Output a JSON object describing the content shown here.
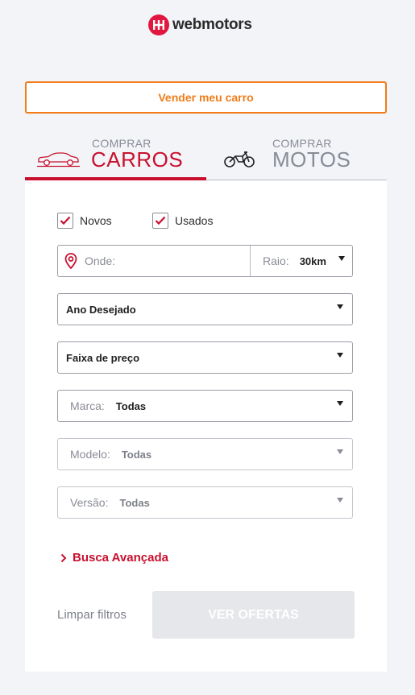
{
  "brand": {
    "name": "webmotors",
    "color": "#e1173f",
    "icon": "webmotors-logo-icon"
  },
  "header": {
    "sell_label": "Vender meu carro",
    "accent": "#f07c1a"
  },
  "tabs": [
    {
      "small": "COMPRAR",
      "big": "CARROS",
      "icon": "car-icon",
      "active": true
    },
    {
      "small": "COMPRAR",
      "big": "MOTOS",
      "icon": "motorcycle-icon",
      "active": false
    }
  ],
  "filters": {
    "new_label": "Novos",
    "new_checked": true,
    "used_label": "Usados",
    "used_checked": true,
    "location": {
      "placeholder": "Onde:",
      "radius_label": "Raio:",
      "radius_value": "30km",
      "icon": "location-pin-icon"
    },
    "year": {
      "value": "Ano Desejado"
    },
    "price": {
      "value": "Faixa de preço"
    },
    "brand": {
      "label": "Marca:",
      "value": "Todas"
    },
    "model": {
      "label": "Modelo:",
      "value": "Todas"
    },
    "version": {
      "label": "Versão:",
      "value": "Todas"
    }
  },
  "advanced_label": "Busca Avançada",
  "actions": {
    "clear_label": "Limpar filtros",
    "offers_label": "VER OFERTAS"
  },
  "colors": {
    "primary": "#c8102e",
    "muted": "#888c96",
    "disabled": "#e6e7ea"
  }
}
